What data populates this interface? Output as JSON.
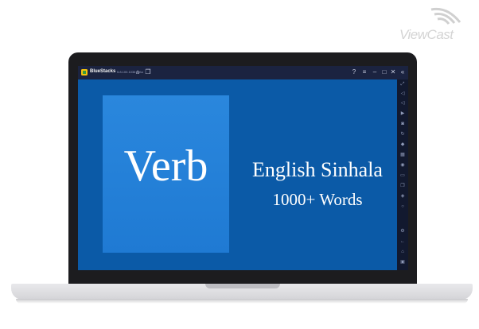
{
  "watermark": {
    "text": "ViewCast"
  },
  "bluestacks": {
    "title": "BlueStacks",
    "version": "5.8.100.1036 Beta",
    "top_icons": [
      "home-icon",
      "multi-instance-icon",
      "help-icon",
      "menu-icon",
      "minimize-icon",
      "maximize-icon",
      "close-icon",
      "collapse-sidebar-icon"
    ],
    "side_icons": [
      "fullscreen-icon",
      "volume-up-icon",
      "volume-down-icon",
      "play-icon",
      "screenshot-icon",
      "rotate-icon",
      "gamepad-icon",
      "keyboard-icon",
      "location-icon",
      "folder-icon",
      "copy-icon",
      "layers-icon",
      "eco-icon",
      "settings-icon",
      "back-icon",
      "home-icon",
      "recent-apps-icon"
    ]
  },
  "app": {
    "verb_label": "Verb",
    "title_line1": "English Sinhala",
    "title_line2": "1000+ Words"
  },
  "colors": {
    "app_background": "#0b5aa7",
    "verb_box": "#1f7ad3",
    "bluestacks_bar": "#1b2340"
  }
}
